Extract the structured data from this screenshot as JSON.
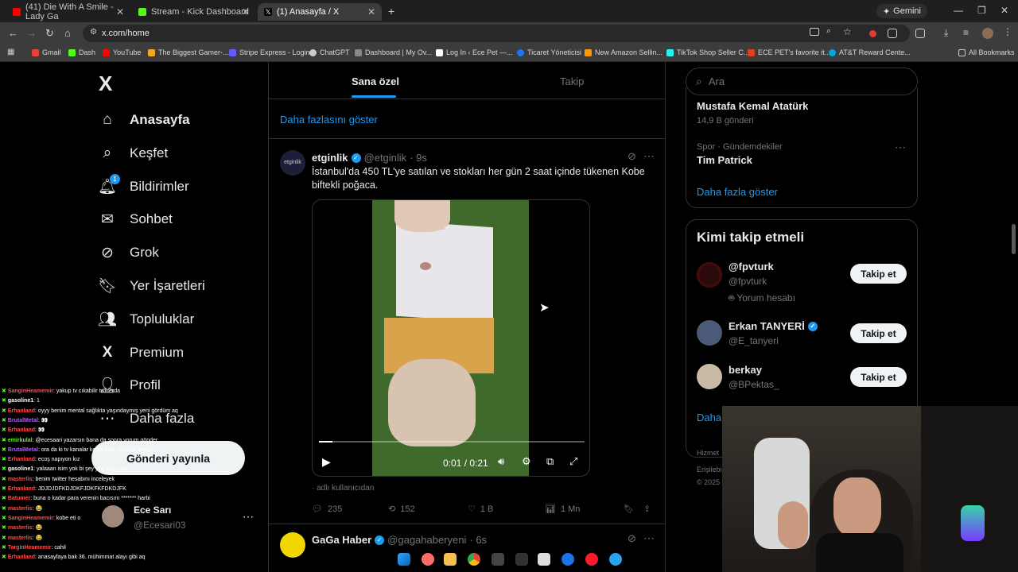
{
  "browser": {
    "tabs": [
      {
        "title": "(41) Die With A Smile - Lady Ga",
        "color": "#ff0000"
      },
      {
        "title": "Stream - Kick Dashboard",
        "color": "#53fc18"
      },
      {
        "title": "(1) Anasayfa / X",
        "color": "#ffffff"
      }
    ],
    "gemini_label": "Gemini",
    "url": "x.com/home",
    "bookmarks": [
      {
        "label": "Gmail",
        "color": "#ea4335"
      },
      {
        "label": "Dash",
        "color": "#53fc18"
      },
      {
        "label": "YouTube",
        "color": "#ff0000"
      },
      {
        "label": "The Biggest Gamer-...",
        "color": "#f5a623"
      },
      {
        "label": "Stripe Express - Login",
        "color": "#635bff"
      },
      {
        "label": "ChatGPT",
        "color": "#cccccc"
      },
      {
        "label": "Dashboard | My Ov...",
        "color": "#888888"
      },
      {
        "label": "Log In ‹ Ece Pet —...",
        "color": "#ffffff"
      },
      {
        "label": "Ticaret Yöneticisi",
        "color": "#1877f2"
      },
      {
        "label": "New Amazon Sellin...",
        "color": "#ff9900"
      },
      {
        "label": "TikTok Shop Seller C...",
        "color": "#25f4ee"
      },
      {
        "label": "ECE PET's favorite it...",
        "color": "#e2401c"
      },
      {
        "label": "AT&T Reward Cente...",
        "color": "#00a8e0"
      }
    ],
    "all_bookmarks": "All Bookmarks"
  },
  "nav": {
    "logo": "X",
    "items": [
      {
        "label": "Anasayfa",
        "icon": "home-icon"
      },
      {
        "label": "Keşfet",
        "icon": "search-icon"
      },
      {
        "label": "Bildirimler",
        "icon": "bell-icon",
        "badge": "1"
      },
      {
        "label": "Sohbet",
        "icon": "mail-icon"
      },
      {
        "label": "Grok",
        "icon": "grok-icon"
      },
      {
        "label": "Yer İşaretleri",
        "icon": "bookmark-icon"
      },
      {
        "label": "Topluluklar",
        "icon": "communities-icon"
      },
      {
        "label": "Premium",
        "icon": "x-icon"
      },
      {
        "label": "Profil",
        "icon": "person-icon"
      },
      {
        "label": "Daha fazla",
        "icon": "more-icon"
      }
    ],
    "post_button": "Gönderi yayınla",
    "account": {
      "name": "Ece Sarı",
      "handle": "@Ecesari03"
    }
  },
  "feed": {
    "tabs": [
      "Sana özel",
      "Takip"
    ],
    "show_more": "Daha fazlasını göster",
    "tweet": {
      "name": "etginlik",
      "handle": "@etginlik",
      "time": "· 9s",
      "text": "İstanbul'da 450 TL'ye satılan ve stokları her gün 2 saat içinde tükenen Kobe biftekli poğaca.",
      "video_time": "0:01 / 0:21",
      "video_progress": 0.05,
      "video_brand": "etginlik",
      "source": "adlı kullanıcıdan",
      "replies": "235",
      "reposts": "152",
      "likes": "1 B",
      "views": "1 Mn"
    },
    "next_tweet": {
      "name": "GaGa Haber",
      "handle": "@gagahaberyeni",
      "time": "· 6s"
    }
  },
  "right": {
    "search_placeholder": "Ara",
    "trend1": {
      "title": "Mustafa Kemal Atatürk",
      "count": "14,9 B gönderi"
    },
    "trend2": {
      "category": "Spor · Gündemdekiler",
      "title": "Tim Patrick"
    },
    "trends_more": "Daha fazla göster",
    "who_to_follow": "Kimi takip etmeli",
    "suggestions": [
      {
        "name": "@fpvturk",
        "handle": "@fpvturk",
        "extra": "Yorum hesabı",
        "button": "Takip et"
      },
      {
        "name": "Erkan TANYERİ",
        "handle": "@E_tanyeri",
        "button": "Takip et"
      },
      {
        "name": "berkay",
        "handle": "@BPektas_",
        "button": "Takip et"
      }
    ],
    "follow_more": "Daha",
    "footer1": "Hizmet",
    "footer2": "Erişilebi",
    "footer3": "© 2025"
  },
  "chat": [
    {
      "user": "SanginHeamemir",
      "msg": ": yakup tv cıkabilir twitterda",
      "color": "#ff4d4d"
    },
    {
      "user": "gasoline1",
      "msg": ": 1",
      "color": "#ffffff"
    },
    {
      "user": "Erhanland",
      "msg": ": oyyy benim mental sağlıkta yaşındaymış yeni gördüm aq",
      "color": "#ff4d4d"
    },
    {
      "user": "BrutalMetal",
      "msg": ": 👀",
      "color": "#b05cff"
    },
    {
      "user": "Erhanland",
      "msg": ": 👀",
      "color": "#ff4d4d"
    },
    {
      "user": "emirkulal",
      "msg": ": @ecesaari yazarsın bana da sonra yorum gönder",
      "color": "#53fc18"
    },
    {
      "user": "BrutalMetal",
      "msg": ": ora da ki tv kanalar kendi bayi yumurta yer mi",
      "color": "#b05cff"
    },
    {
      "user": "Erhanland",
      "msg": ": ecoş napıyon kız",
      "color": "#ff4d4d"
    },
    {
      "user": "gasoline1",
      "msg": ": yalaaan isim yok bi şey yok sizin yapı",
      "color": "#ffffff"
    },
    {
      "user": "masterlis",
      "msg": ": benim twitter hesabını inceleyek",
      "color": "#ff4d4d"
    },
    {
      "user": "Erhanland",
      "msg": ": JDJDJDFKDJDKFJDKFKFDKDJFK",
      "color": "#ff4d4d"
    },
    {
      "user": "Batumer",
      "msg": ": buna o kadar para verenin bacısını ******* harbi",
      "color": "#ff4d4d"
    },
    {
      "user": "masterlis",
      "msg": ": 😂",
      "color": "#ff4d4d"
    },
    {
      "user": "SanginHeamemir",
      "msg": ": kobe eti o",
      "color": "#ff4d4d"
    },
    {
      "user": "masterlis",
      "msg": ": 😂",
      "color": "#ff4d4d"
    },
    {
      "user": "masterlis",
      "msg": ": 😂",
      "color": "#ff4d4d"
    },
    {
      "user": "TarginHeamemir",
      "msg": ": cahil",
      "color": "#ff4d4d"
    },
    {
      "user": "Erhanland",
      "msg": ": anasayfaya bak 36. mühimmat alayı gibi aq",
      "color": "#ff4d4d"
    }
  ]
}
